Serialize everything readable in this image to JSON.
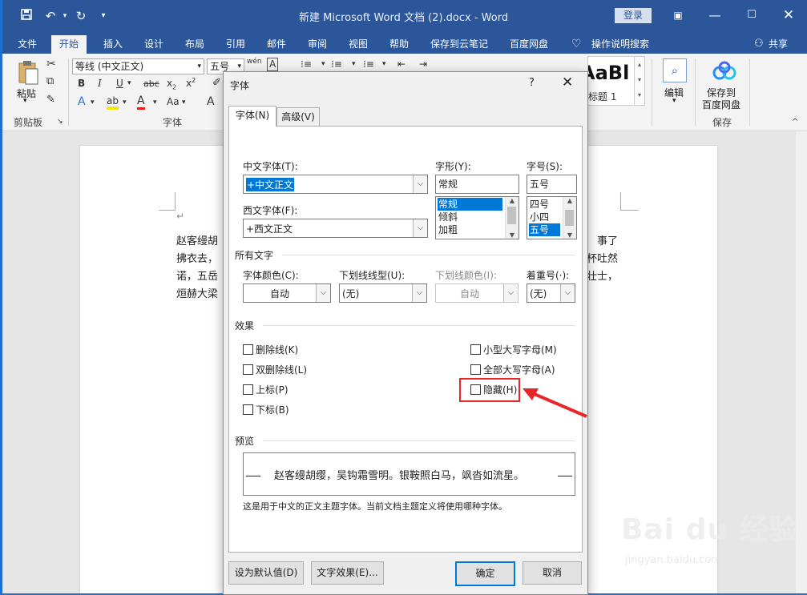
{
  "window": {
    "title": "新建 Microsoft Word 文档 (2).docx  -  Word",
    "login": "登录"
  },
  "tabs": [
    "文件",
    "开始",
    "插入",
    "设计",
    "布局",
    "引用",
    "邮件",
    "审阅",
    "视图",
    "帮助",
    "保存到云笔记",
    "百度网盘",
    "操作说明搜索"
  ],
  "share": "共享",
  "ribbon": {
    "paste": "粘贴",
    "clipboard": "剪贴板",
    "font_name": "等线 (中文正文)",
    "font_size": "五号",
    "font_group": "字体",
    "style_sample": "AaBl",
    "style_name": "标题 1",
    "edit": "编辑",
    "save_to_label": "保存到",
    "baidu_pan": "百度网盘",
    "save_group": "保存"
  },
  "document": {
    "lines": [
      "赵客缦胡",
      "拂衣去，",
      "诺，五岳",
      "烜赫大梁"
    ],
    "right_lines": [
      "事了",
      "杯吐然",
      "壮士，"
    ],
    "return_mark": "↵"
  },
  "dialog": {
    "title": "字体",
    "help": "?",
    "tabs": {
      "font": "字体(N)",
      "advanced": "高级(V)"
    },
    "cn_font_label": "中文字体(T):",
    "cn_font_value": "+中文正文",
    "west_font_label": "西文字体(F):",
    "west_font_value": "+西文正文",
    "style_label": "字形(Y):",
    "style_value": "常规",
    "style_options": [
      "常规",
      "倾斜",
      "加粗"
    ],
    "size_label": "字号(S):",
    "size_value": "五号",
    "size_options": [
      "四号",
      "小四",
      "五号"
    ],
    "all_text_section": "所有文字",
    "color_label": "字体颜色(C):",
    "color_value": "自动",
    "underline_label": "下划线线型(U):",
    "underline_value": "(无)",
    "underline_color_label": "下划线颜色(I):",
    "underline_color_value": "自动",
    "emphasis_label": "着重号(·):",
    "emphasis_value": "(无)",
    "effects_section": "效果",
    "effects_left": [
      "删除线(K)",
      "双删除线(L)",
      "上标(P)",
      "下标(B)"
    ],
    "effects_right": [
      "小型大写字母(M)",
      "全部大写字母(A)",
      "隐藏(H)"
    ],
    "preview_section": "预览",
    "preview_text": "赵客缦胡缨，吴钩霜雪明。银鞍照白马，飒沓如流星。",
    "preview_note": "这是用于中文的正文主题字体。当前文档主题定义将使用哪种字体。",
    "btn_default": "设为默认值(D)",
    "btn_effects": "文字效果(E)...",
    "btn_ok": "确定",
    "btn_cancel": "取消"
  },
  "watermark": {
    "logo": "Bai du 经验",
    "url": "jingyan.baidu.com"
  },
  "colors": {
    "accent": "#2b579a",
    "highlight": "#e8262a",
    "selection": "#0078d7"
  }
}
